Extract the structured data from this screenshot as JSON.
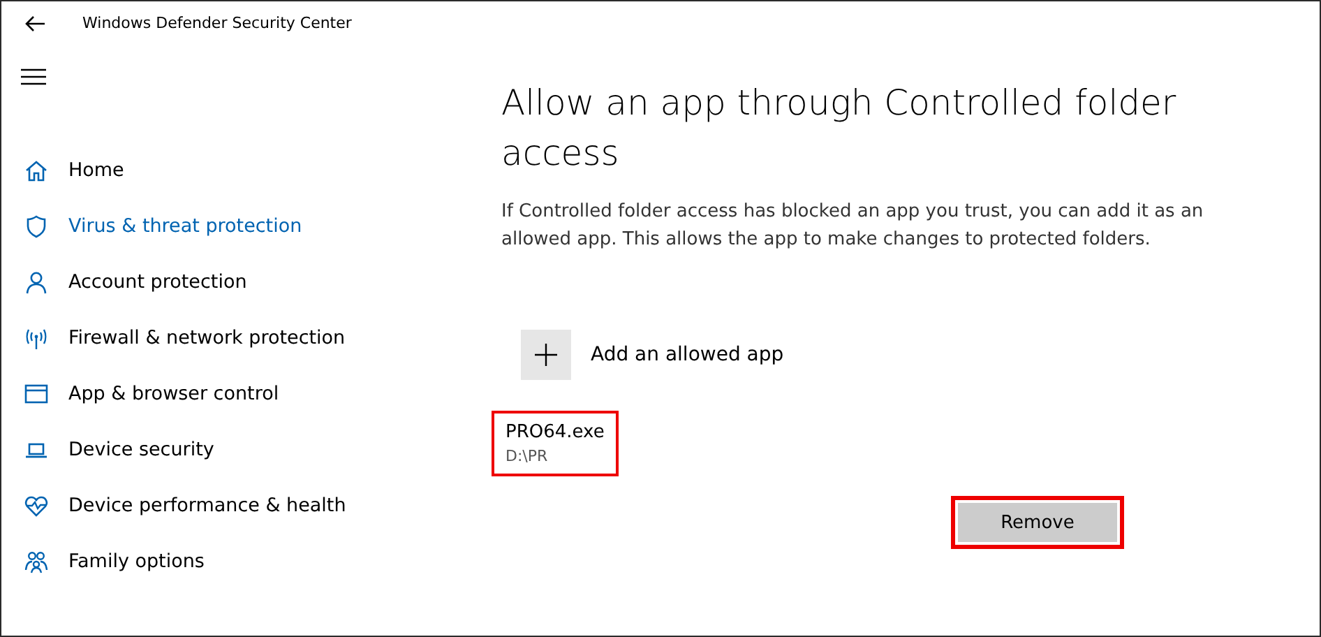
{
  "window": {
    "title": "Windows Defender Security Center"
  },
  "sidebar": {
    "items": [
      {
        "label": "Home",
        "selected": false
      },
      {
        "label": "Virus & threat protection",
        "selected": true
      },
      {
        "label": "Account protection",
        "selected": false
      },
      {
        "label": "Firewall & network protection",
        "selected": false
      },
      {
        "label": "App & browser control",
        "selected": false
      },
      {
        "label": "Device security",
        "selected": false
      },
      {
        "label": "Device performance & health",
        "selected": false
      },
      {
        "label": "Family options",
        "selected": false
      }
    ]
  },
  "content": {
    "heading": "Allow an app through Controlled folder access",
    "description": "If Controlled folder access has blocked an app you trust, you can add it as an allowed app. This allows the app to make changes to protected folders.",
    "add_button": "Add an allowed app",
    "apps": [
      {
        "name": "PRO64.exe",
        "path": "D:\\PR",
        "highlighted": true
      }
    ],
    "remove_button": {
      "label": "Remove",
      "highlighted": true
    }
  }
}
